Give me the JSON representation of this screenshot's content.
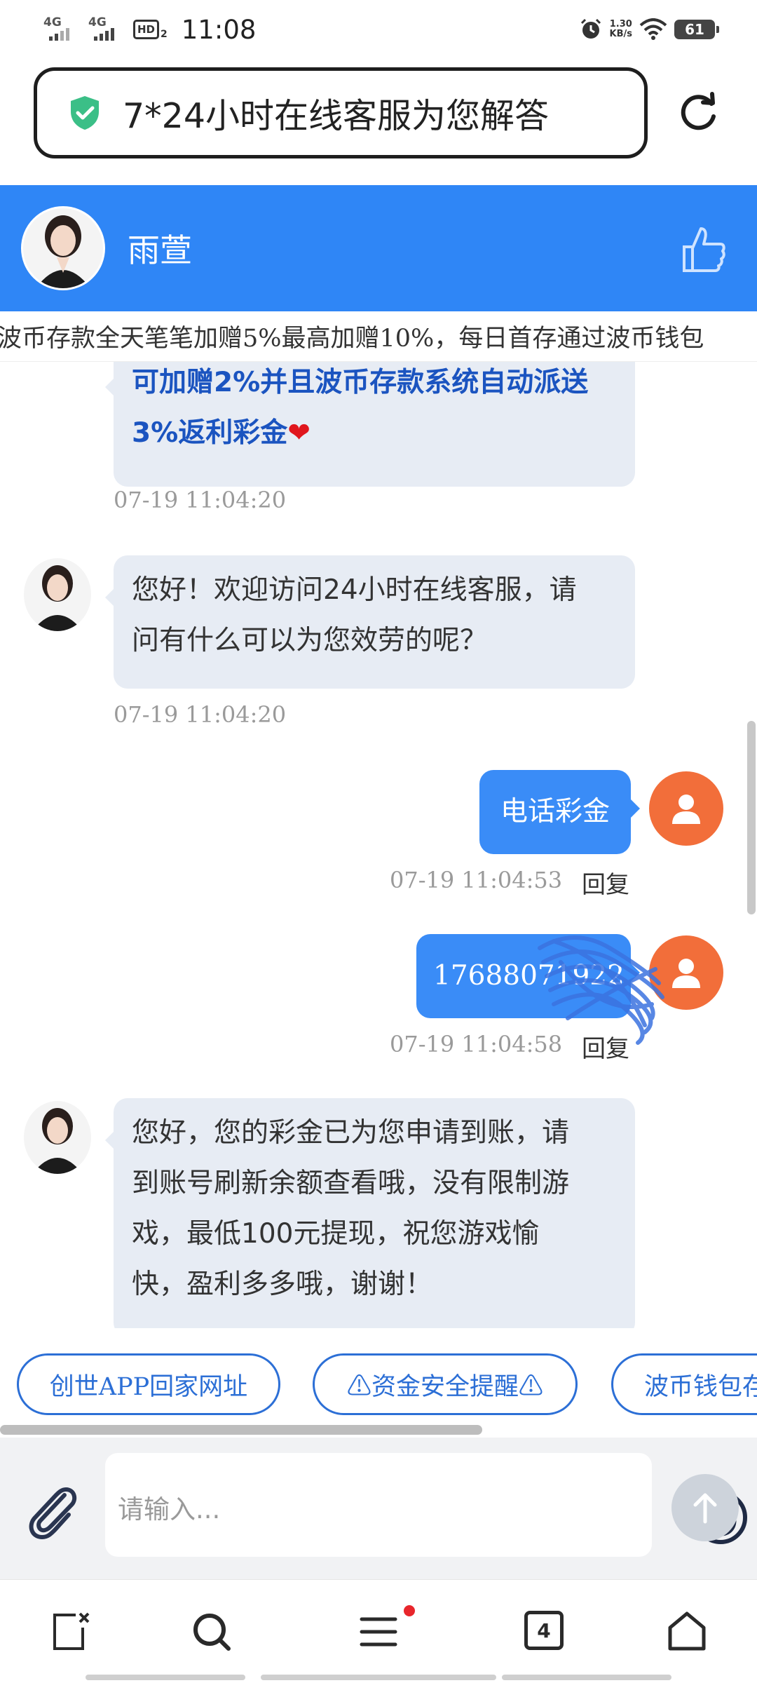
{
  "status_bar": {
    "net1": "4G",
    "net2": "4G",
    "hd": "HD",
    "hd_sub": "2",
    "time": "11:08",
    "speed_value": "1.30",
    "speed_unit": "KB/s",
    "battery": "61"
  },
  "browser": {
    "url_text": "7*24小时在线客服为您解答"
  },
  "chat_header": {
    "agent_name": "雨萱"
  },
  "marquee": {
    "text": "波币存款全天笔笔加赠5%最高加赠10%，每日首存通过波币钱包"
  },
  "messages": [
    {
      "line1": "可加赠2%并且波币存款系统自动派送",
      "line2": "3%返利彩金",
      "heart": "❤",
      "time": "07-19 11:04:20"
    },
    {
      "line1": "您好！欢迎访问24小时在线客服，请",
      "line2": "问有什么可以为您效劳的呢？",
      "time": "07-19 11:04:20"
    },
    {
      "text": "电话彩金",
      "time": "07-19 11:04:53",
      "reply": "回复"
    },
    {
      "text": "17688071922",
      "time": "07-19 11:04:58",
      "reply": "回复"
    },
    {
      "line1": "您好，您的彩金已为您申请到账，请",
      "line2": "到账号刷新余额查看哦，没有限制游",
      "line3": "戏，最低100元提现，祝您游戏愉",
      "line4": "快，盈利多多哦，谢谢！"
    }
  ],
  "quick_replies": [
    "创世APP回家网址",
    "⚠资金安全提醒⚠",
    "波币钱包存"
  ],
  "input": {
    "placeholder": "请输入..."
  },
  "bottom_nav": {
    "tabs_count": "4"
  },
  "colors": {
    "header_blue": "#2f86f6",
    "user_bubble": "#3a8cf7",
    "user_avatar": "#f26e3a",
    "promo_text": "#1b54c0"
  }
}
